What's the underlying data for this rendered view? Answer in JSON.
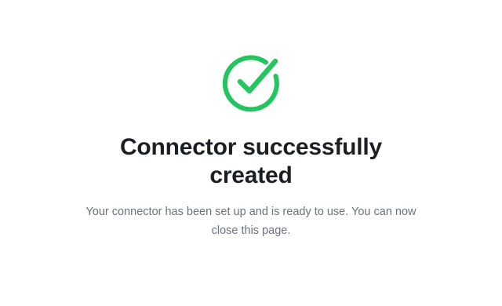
{
  "status": {
    "icon": "check-circle-icon",
    "color": "#22c55e",
    "title": "Connector successfully created",
    "message": "Your connector has been set up and is ready to use. You can now close this page."
  }
}
